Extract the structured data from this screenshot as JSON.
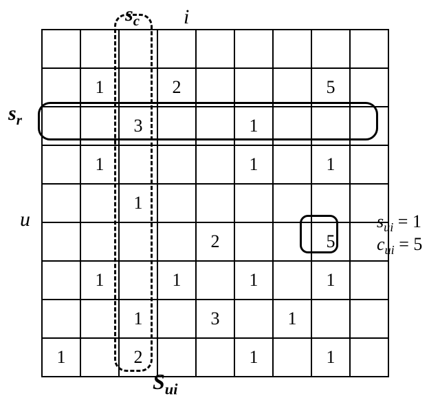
{
  "labels": {
    "s_c": "s",
    "s_c_sub": "c",
    "i": "i",
    "s_r": "s",
    "s_r_sub": "r",
    "u": "u",
    "S_ui": "S",
    "S_ui_sub": "ui",
    "eq1_lhs": "s",
    "eq1_sub": "ui",
    "eq1_rhs": "1",
    "eq2_lhs": "c",
    "eq2_sub": "ui",
    "eq2_rhs": "5"
  },
  "grid": {
    "rows": 9,
    "cols": 9,
    "cells": [
      [
        "",
        "",
        "",
        "",
        "",
        "",
        "",
        "",
        ""
      ],
      [
        "",
        "1",
        "",
        "2",
        "",
        "",
        "",
        "5",
        ""
      ],
      [
        "",
        "",
        "3",
        "",
        "",
        "1",
        "",
        "",
        ""
      ],
      [
        "",
        "1",
        "",
        "",
        "",
        "1",
        "",
        "1",
        ""
      ],
      [
        "",
        "",
        "1",
        "",
        "",
        "",
        "",
        "",
        ""
      ],
      [
        "",
        "",
        "",
        "",
        "2",
        "",
        "",
        "5",
        ""
      ],
      [
        "",
        "1",
        "",
        "1",
        "",
        "1",
        "",
        "1",
        ""
      ],
      [
        "",
        "",
        "1",
        "",
        "3",
        "",
        "1",
        "",
        ""
      ],
      [
        "1",
        "",
        "2",
        "",
        "",
        "1",
        "",
        "1",
        ""
      ]
    ]
  },
  "chart_data": {
    "type": "table",
    "description": "Sparse user-item interaction matrix S_{ui}. Row index u, column index i. s_r = highlighted row vector, s_c = highlighted column vector. Single highlighted cell (row 5, col 7) with s_{ui}=1, c_{ui}=5.",
    "n_rows": 9,
    "n_cols": 9,
    "entries": [
      {
        "row": 1,
        "col": 1,
        "value": 1
      },
      {
        "row": 1,
        "col": 3,
        "value": 2
      },
      {
        "row": 1,
        "col": 7,
        "value": 5
      },
      {
        "row": 2,
        "col": 2,
        "value": 3
      },
      {
        "row": 2,
        "col": 5,
        "value": 1
      },
      {
        "row": 3,
        "col": 1,
        "value": 1
      },
      {
        "row": 3,
        "col": 5,
        "value": 1
      },
      {
        "row": 3,
        "col": 7,
        "value": 1
      },
      {
        "row": 4,
        "col": 2,
        "value": 1
      },
      {
        "row": 5,
        "col": 4,
        "value": 2
      },
      {
        "row": 5,
        "col": 7,
        "value": 5
      },
      {
        "row": 6,
        "col": 1,
        "value": 1
      },
      {
        "row": 6,
        "col": 3,
        "value": 1
      },
      {
        "row": 6,
        "col": 5,
        "value": 1
      },
      {
        "row": 6,
        "col": 7,
        "value": 1
      },
      {
        "row": 7,
        "col": 2,
        "value": 1
      },
      {
        "row": 7,
        "col": 4,
        "value": 3
      },
      {
        "row": 7,
        "col": 6,
        "value": 1
      },
      {
        "row": 8,
        "col": 0,
        "value": 1
      },
      {
        "row": 8,
        "col": 2,
        "value": 2
      },
      {
        "row": 8,
        "col": 5,
        "value": 1
      },
      {
        "row": 8,
        "col": 7,
        "value": 1
      }
    ],
    "highlight_row_index": 2,
    "highlight_col_index": 2,
    "highlight_cell": {
      "row": 5,
      "col": 7,
      "s_ui": 1,
      "c_ui": 5
    }
  }
}
